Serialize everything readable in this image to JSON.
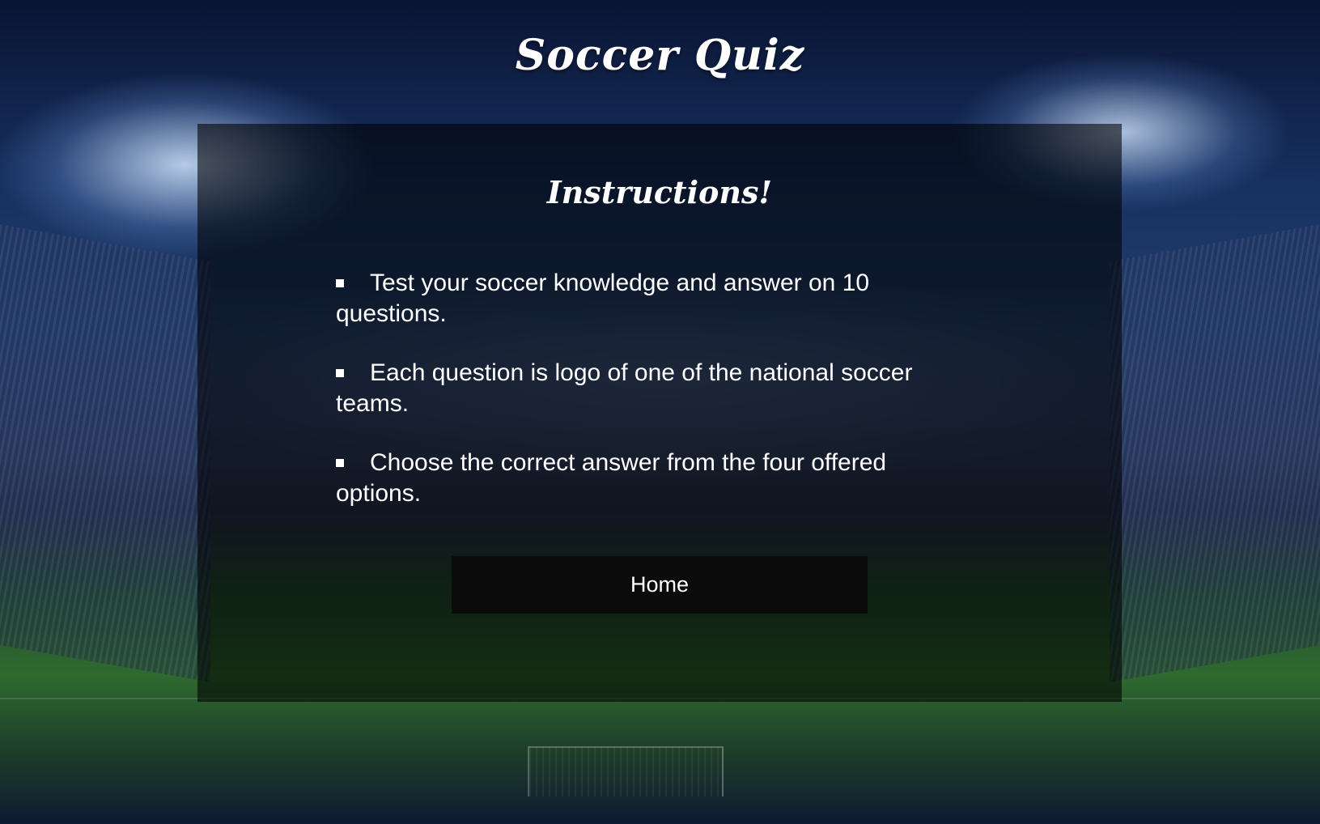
{
  "page": {
    "title": "Soccer Quiz"
  },
  "panel": {
    "heading": "Instructions!",
    "items": [
      "Test your soccer knowledge and answer on 10 questions.",
      "Each question is logo of one of the national soccer teams.",
      "Choose the correct answer from the four offered options."
    ],
    "home_button_label": "Home"
  },
  "colors": {
    "panel_overlay": "#000000",
    "button_background": "#0b0b0b",
    "text": "#ffffff",
    "background_primary": "#16305f"
  },
  "icons": {
    "list_bullet": "square-bullet-icon"
  }
}
